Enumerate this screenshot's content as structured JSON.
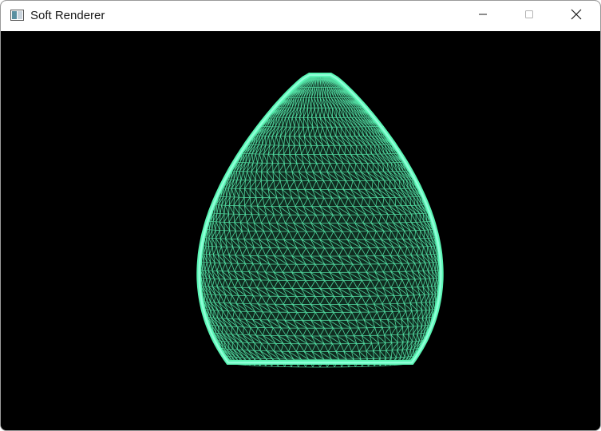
{
  "window": {
    "title": "Soft Renderer",
    "icons": {
      "app": "app-window-icon",
      "minimize": "minimize-icon",
      "maximize": "maximize-icon",
      "close": "close-icon"
    }
  },
  "viewport": {
    "background_color": "#000000",
    "mesh_color": "#5af5b4",
    "mesh_highlight_color": "#8fffd8",
    "render_mode": "wireframe",
    "model_shape": "rounded-cone"
  }
}
